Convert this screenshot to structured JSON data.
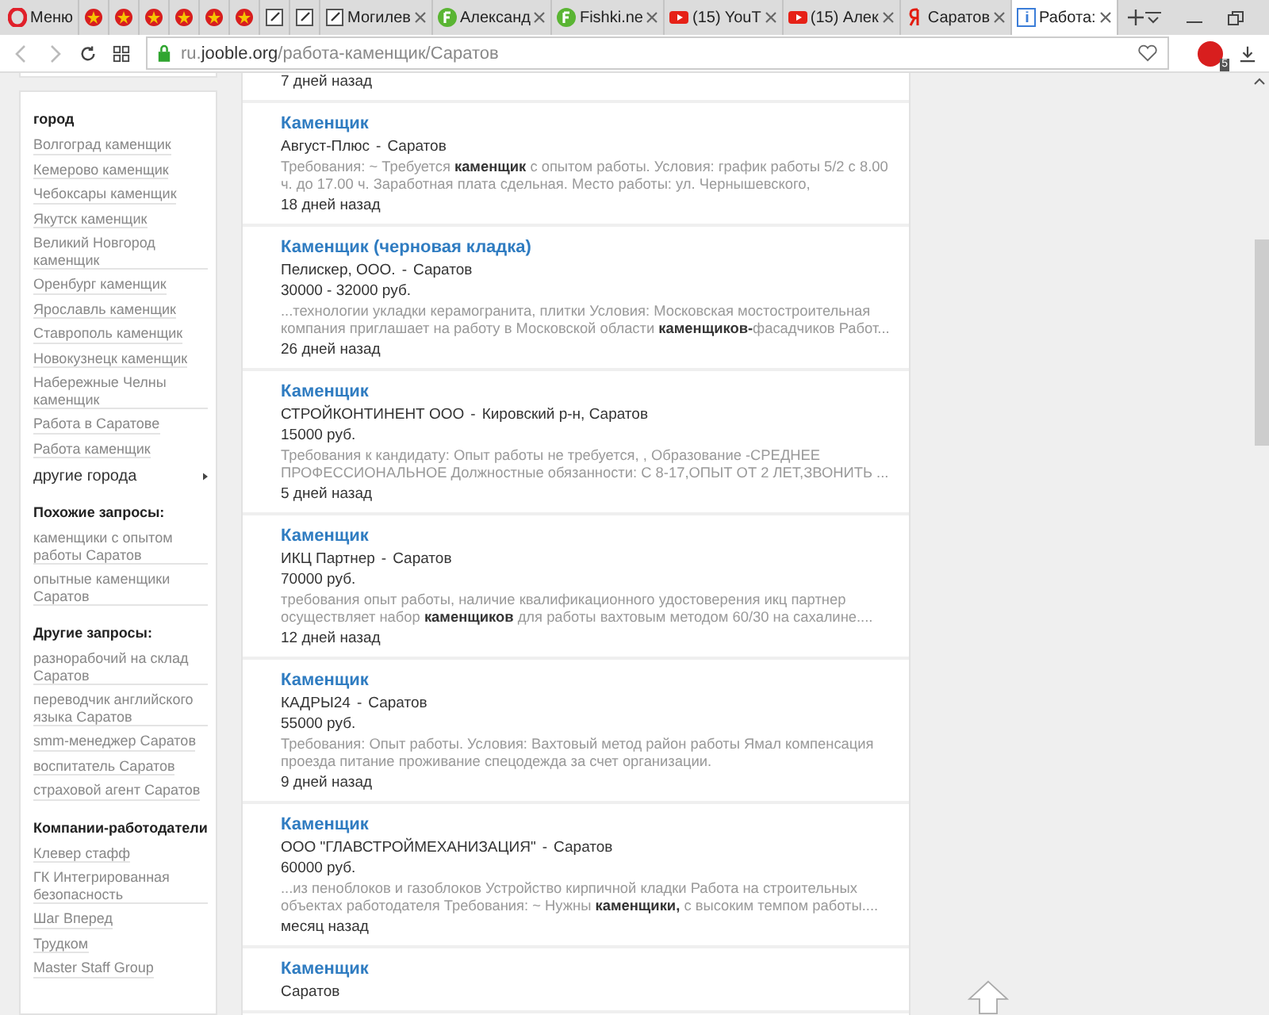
{
  "tabs": [
    {
      "kind": "opera",
      "label": "Меню",
      "selected": false
    },
    {
      "kind": "star",
      "selected": false
    },
    {
      "kind": "star",
      "selected": false
    },
    {
      "kind": "star",
      "selected": false
    },
    {
      "kind": "star",
      "selected": false
    },
    {
      "kind": "star",
      "selected": false
    },
    {
      "kind": "star",
      "selected": false
    },
    {
      "kind": "note",
      "selected": false
    },
    {
      "kind": "note",
      "selected": false
    },
    {
      "kind": "note",
      "label": "Могилев",
      "selected": false
    },
    {
      "kind": "fishki",
      "label": "Александ",
      "selected": false
    },
    {
      "kind": "fishki",
      "label": "Fishki.ne",
      "selected": false
    },
    {
      "kind": "youtube",
      "label": "(15) YouT",
      "selected": false
    },
    {
      "kind": "youtube",
      "label": "(15) Алек",
      "selected": false
    },
    {
      "kind": "yandex",
      "label": "Саратов",
      "selected": false
    },
    {
      "kind": "jooble",
      "label": "Работа:",
      "selected": true
    }
  ],
  "address_bar": {
    "url": "ru.**jooble.org**/работа-каменщик/Саратов",
    "adblock_count": "5"
  },
  "sidebar": [
    {
      "heading": "город",
      "links": [
        "Волгоград каменщик",
        "Кемерово каменщик",
        "Чебоксары каменщик",
        "Якутск каменщик",
        "Великий Новгород каменщик",
        "Оренбург каменщик",
        "Ярославль каменщик",
        "Ставрополь каменщик",
        "Новокузнецк каменщик",
        "Набережные Челны каменщик",
        "Работа в Саратове",
        "Работа каменщик"
      ],
      "more": "другие города"
    },
    {
      "heading": "Похожие запросы:",
      "links": [
        "каменщики с опытом работы Саратов",
        "опытные каменщики Саратов"
      ]
    },
    {
      "heading": "Другие запросы:",
      "links": [
        "разнорабочий на склад Саратов",
        "переводчик английского языка Саратов",
        "smm-менеджер Саратов",
        "воспитатель Саратов",
        "страховой агент Саратов"
      ]
    },
    {
      "heading": "Компании-работодатели",
      "links": [
        "Клевер стафф",
        "ГК Интегрированная безопасность",
        "Шаг Вперед",
        "Трудком",
        "Master Staff Group"
      ]
    }
  ],
  "jobs": [
    {
      "age": "7 дней назад"
    },
    {
      "title": "Каменщик",
      "company": "Август-Плюс",
      "separator": "-",
      "location": "Саратов",
      "snippet": "Требования: ~ Требуется **каменщик** с опытом работы. Условия: график работы 5/2 с 8.00 ч. до 17.00 ч. Заработная плата сдельная. Место работы: ул. Чернышевского,",
      "age": "18 дней назад"
    },
    {
      "title": "Каменщик (черновая кладка)",
      "company": "Пелискер, ООО.",
      "separator": "-",
      "location": "Саратов",
      "salary": "30000 - 32000 руб.",
      "snippet": "...технологии укладки керамогранита, плитки Условия: Московская мостостроительная компания приглашает на работу в Московской области **каменщиков-**фасадчиков Работ...",
      "age": "26 дней назад"
    },
    {
      "title": "Каменщик",
      "company": "СТРОЙКОНТИНЕНТ ООО",
      "separator": "-",
      "location": "Кировский р-н, Саратов",
      "salary": "15000 руб.",
      "snippet": "Требования к кандидату: Опыт работы не требуется, , Образование -СРЕДНЕЕ ПРОФЕССИОНАЛЬНОЕ Должностные обязанности: С 8-17,ОПЫТ ОТ 2 ЛЕТ,ЗВОНИТЬ ...",
      "age": "5 дней назад"
    },
    {
      "title": "Каменщик",
      "company": "ИКЦ Партнер",
      "separator": "-",
      "location": "Саратов",
      "salary": "70000 руб.",
      "snippet": "требования опыт работы, наличие квалификационного удостоверения икц партнер осуществляет набор **каменщиков** для работы вахтовым методом 60/30 на сахалине....",
      "age": "12 дней назад"
    },
    {
      "title": "Каменщик",
      "company": "КАДРЫ24",
      "separator": "-",
      "location": "Саратов",
      "salary": "55000 руб.",
      "snippet": "Требования: Опыт работы. Условия: Вахтовый метод район работы Ямал компенсация проезда питание проживание спецодежда за счет организации.",
      "age": "9 дней назад"
    },
    {
      "title": "Каменщик",
      "company": "ООО \"ГЛАВСТРОЙМЕХАНИЗАЦИЯ\"",
      "separator": "-",
      "location": "Саратов",
      "salary": "60000 руб.",
      "snippet": "...из пеноблоков и газоблоков Устройство кирпичной кладки Работа на строительных объектах работодателя Требования: ~ Нужны **каменщики,** с высоким темпом работы....",
      "age": "месяц назад"
    },
    {
      "title": "Каменщик",
      "location": "Саратов"
    }
  ]
}
